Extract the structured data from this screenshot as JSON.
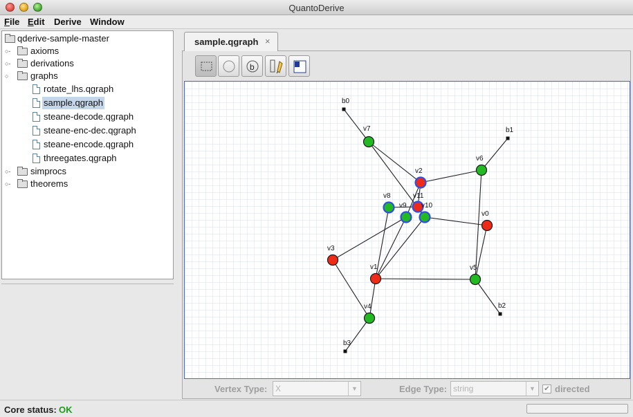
{
  "window": {
    "title": "QuantoDerive"
  },
  "menu": [
    {
      "ul": "F",
      "rest": "ile"
    },
    {
      "ul": "E",
      "rest": "dit"
    },
    {
      "ul": "",
      "rest": "Derive"
    },
    {
      "ul": "",
      "rest": "Window"
    }
  ],
  "tree": {
    "root": "qderive-sample-master",
    "folders": {
      "axioms": "axioms",
      "derivations": "derivations",
      "graphs": "graphs",
      "simprocs": "simprocs",
      "theorems": "theorems"
    },
    "files": [
      "rotate_lhs.qgraph",
      "sample.qgraph",
      "steane-decode.qgraph",
      "steane-enc-dec.qgraph",
      "steane-encode.qgraph",
      "threegates.qgraph"
    ]
  },
  "editor": {
    "tab_label": "sample.qgraph",
    "tab_close": "×",
    "tools": [
      "select-tool-icon",
      "add-vertex-tool-icon",
      "add-boundary-tool-icon",
      "add-edge-tool-icon",
      "bang-box-tool-icon"
    ]
  },
  "graph": {
    "colors": {
      "green": "#22b922",
      "red": "#ee2a18",
      "boundary": "#111111",
      "highlight": "#2f4fe0",
      "grid": "#d4dcec"
    },
    "vertices": [
      {
        "id": "b0",
        "kind": "boundary",
        "label": "b0"
      },
      {
        "id": "b1",
        "kind": "boundary",
        "label": "b1"
      },
      {
        "id": "b2",
        "kind": "boundary",
        "label": "b2"
      },
      {
        "id": "b3",
        "kind": "boundary",
        "label": "b3"
      },
      {
        "id": "v7",
        "kind": "green",
        "label": "v7"
      },
      {
        "id": "v6",
        "kind": "green",
        "label": "v6"
      },
      {
        "id": "v2",
        "kind": "red",
        "label": "v2",
        "selected": true
      },
      {
        "id": "v8",
        "kind": "green",
        "label": "v8",
        "selected": true
      },
      {
        "id": "v11",
        "kind": "red",
        "label": "v11",
        "selected": true
      },
      {
        "id": "v9",
        "kind": "green",
        "label": "v9",
        "selected": true
      },
      {
        "id": "v10",
        "kind": "green",
        "label": "v10",
        "selected": true
      },
      {
        "id": "v0",
        "kind": "red",
        "label": "v0"
      },
      {
        "id": "v3",
        "kind": "red",
        "label": "v3"
      },
      {
        "id": "v1",
        "kind": "red",
        "label": "v1"
      },
      {
        "id": "v5",
        "kind": "green",
        "label": "v5"
      },
      {
        "id": "v4",
        "kind": "green",
        "label": "v4"
      }
    ],
    "edges": [
      [
        "b0",
        "v7"
      ],
      [
        "v7",
        "v2"
      ],
      [
        "v7",
        "v10"
      ],
      [
        "b1",
        "v6"
      ],
      [
        "v6",
        "v2"
      ],
      [
        "v6",
        "v5"
      ],
      [
        "v2",
        "v11"
      ],
      [
        "v2",
        "v9"
      ],
      [
        "v8",
        "v11"
      ],
      [
        "v8",
        "v1"
      ],
      [
        "v11",
        "v10"
      ],
      [
        "v9",
        "v1"
      ],
      [
        "v10",
        "v1"
      ],
      [
        "v10",
        "v0"
      ],
      [
        "v9",
        "v3"
      ],
      [
        "v0",
        "v5"
      ],
      [
        "v3",
        "v4"
      ],
      [
        "v1",
        "v4"
      ],
      [
        "v1",
        "v5"
      ],
      [
        "v5",
        "b2"
      ],
      [
        "v4",
        "b3"
      ]
    ]
  },
  "bottombar": {
    "vertex_type_label": "Vertex Type:",
    "vertex_type_value": "X",
    "edge_type_label": "Edge Type:",
    "edge_type_value": "string",
    "directed_label": "directed",
    "directed_checked": true
  },
  "status": {
    "label": "Core status:",
    "value": "OK",
    "value_color": "#1c9b1c"
  }
}
